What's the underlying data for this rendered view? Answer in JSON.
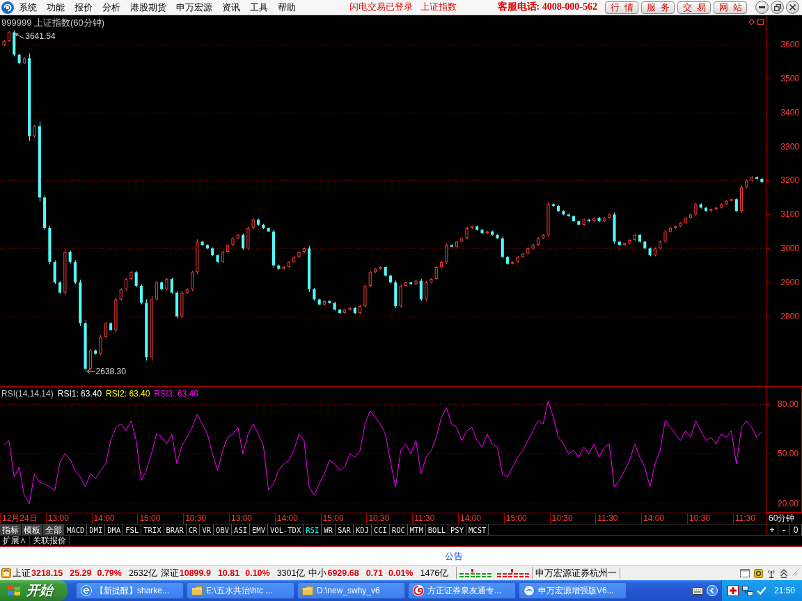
{
  "menu_bar": {
    "items": [
      "系统",
      "功能",
      "报价",
      "分析",
      "港股期货",
      "申万宏源",
      "资讯",
      "工具",
      "帮助"
    ],
    "notices": [
      "闪电交易已登录",
      "上证指数"
    ],
    "hotline": "客服电话: 4008-000-562",
    "buttons": [
      "行情",
      "服务",
      "交易",
      "网站"
    ]
  },
  "price_panel": {
    "title": "999999 上证指数(60分钟)",
    "axis_labels": [
      "3600",
      "3500",
      "3400",
      "3300",
      "3200",
      "3100",
      "3000",
      "2900",
      "2800"
    ],
    "extremes": [
      {
        "text": "3641.54",
        "kind": "high"
      },
      {
        "text": "2638.30",
        "kind": "low"
      }
    ]
  },
  "rsi_panel": {
    "legend": [
      {
        "text": "RSI1: 63.40",
        "color": "#ffffff"
      },
      {
        "text": "RSI2: 63.40",
        "color": "#ffff00"
      },
      {
        "text": "RSI3: 63.40",
        "color": "#ff00ff"
      }
    ],
    "chart_data": {
      "type": "line",
      "title": "RSI(14,14,14)",
      "ylim": [
        14.5,
        90.5
      ],
      "yticks": [
        {
          "value": 20,
          "label": "20.00"
        },
        {
          "value": 50,
          "label": "50.00"
        },
        {
          "value": 80,
          "label": "80.00"
        }
      ],
      "grid": true,
      "series": [
        {
          "color": "#ff00ff",
          "values": [
            55,
            58,
            36,
            42,
            25,
            20,
            38,
            33,
            32,
            30,
            28,
            45,
            50,
            47,
            40,
            36,
            30,
            38,
            35,
            40,
            44,
            58,
            66,
            68,
            64,
            70,
            58,
            34,
            40,
            50,
            62,
            60,
            56,
            62,
            44,
            55,
            60,
            66,
            74,
            68,
            62,
            50,
            40,
            52,
            60,
            62,
            66,
            50,
            62,
            68,
            62,
            55,
            28,
            32,
            40,
            44,
            46,
            52,
            62,
            58,
            30,
            25,
            32,
            38,
            46,
            44,
            40,
            42,
            50,
            48,
            52,
            68,
            76,
            72,
            68,
            62,
            45,
            30,
            52,
            56,
            50,
            58,
            38,
            48,
            52,
            60,
            72,
            78,
            68,
            66,
            58,
            64,
            66,
            58,
            54,
            62,
            56,
            54,
            38,
            36,
            42,
            48,
            52,
            58,
            64,
            70,
            68,
            82,
            72,
            60,
            56,
            50,
            52,
            48,
            54,
            50,
            56,
            48,
            54,
            56,
            30,
            34,
            40,
            46,
            56,
            48,
            42,
            30,
            44,
            52,
            70,
            66,
            62,
            58,
            64,
            60,
            70,
            64,
            58,
            60,
            56,
            62,
            60,
            64,
            44,
            66,
            70,
            66,
            60,
            63.4
          ]
        }
      ]
    }
  },
  "time_axis": {
    "labels": [
      "12月24日",
      "13:00",
      "14:00",
      "15:00",
      "10:30",
      "13:00",
      "14:00",
      "15:00",
      "10:30",
      "11:30",
      "14:00",
      "15:00",
      "10:30",
      "11:30",
      "14:00",
      "10:30",
      "11:30"
    ],
    "period": "60分钟"
  },
  "indicator_bar": {
    "groups": [
      "指标",
      "模板",
      "全部"
    ],
    "tabs": [
      {
        "label": "MACD",
        "selected": false
      },
      {
        "label": "DMI",
        "selected": false
      },
      {
        "label": "DMA",
        "selected": false
      },
      {
        "label": "FSL",
        "selected": false
      },
      {
        "label": "TRIX",
        "selected": false
      },
      {
        "label": "BRAR",
        "selected": false
      },
      {
        "label": "CR",
        "selected": false
      },
      {
        "label": "VR",
        "selected": false
      },
      {
        "label": "OBV",
        "selected": false
      },
      {
        "label": "ASI",
        "selected": false
      },
      {
        "label": "EMV",
        "selected": false
      },
      {
        "label": "VOL-TDX",
        "selected": false
      },
      {
        "label": "RSI",
        "selected": true
      },
      {
        "label": "WR",
        "selected": false
      },
      {
        "label": "SAR",
        "selected": false
      },
      {
        "label": "KDJ",
        "selected": false
      },
      {
        "label": "CCI",
        "selected": false
      },
      {
        "label": "ROC",
        "selected": false
      },
      {
        "label": "MTM",
        "selected": false
      },
      {
        "label": "BOLL",
        "selected": false
      },
      {
        "label": "PSY",
        "selected": false
      },
      {
        "label": "MCST",
        "selected": false
      }
    ],
    "zoom_buttons": [
      "+",
      "-",
      "0"
    ]
  },
  "extra_tabs": [
    "扩展∧",
    "关联报价"
  ],
  "notice": "公告",
  "status_bar": {
    "indices": [
      {
        "name": "上证",
        "value": "3218.15",
        "change": "25.29",
        "percent": "0.79%",
        "amount": "2632亿",
        "up": true
      },
      {
        "name": "深证",
        "value": "10899.9",
        "change": "10.81",
        "percent": "0.10%",
        "amount": "3301亿",
        "up": true
      },
      {
        "name": "中小",
        "value": "6929.68",
        "change": "0.71",
        "percent": "0.01%",
        "amount": "1476亿",
        "up": true
      }
    ],
    "broker": "申万宏源证券杭州一"
  },
  "taskbar": {
    "start": "开始",
    "tasks": [
      {
        "label": "【新提醒】sharke...",
        "kind": "browser"
      },
      {
        "label": "E:\\五水共治\\htc ...",
        "kind": "folder"
      },
      {
        "label": "D:\\new_swhy_v6",
        "kind": "folder"
      },
      {
        "label": "方正证券泉友通专...",
        "kind": "swirl"
      },
      {
        "label": "申万宏源增强版V6...",
        "kind": "app"
      }
    ],
    "clock": "21:50"
  }
}
